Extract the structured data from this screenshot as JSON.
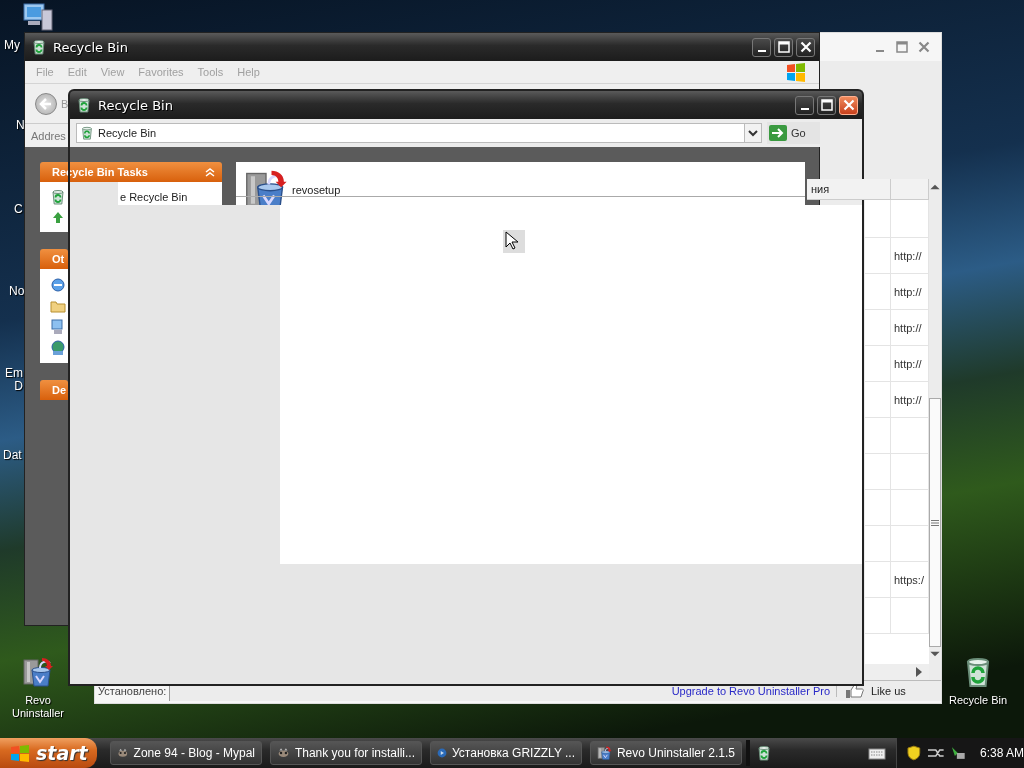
{
  "desktop": {
    "labels_left": [
      {
        "lines": [
          "My"
        ]
      },
      {
        "lines": [
          "N"
        ]
      },
      {
        "lines": [
          "C"
        ]
      },
      {
        "lines": [
          "No"
        ]
      },
      {
        "lines": [
          "Em",
          "D"
        ]
      },
      {
        "lines": [
          "Dat"
        ]
      }
    ],
    "shortcuts": [
      {
        "kind": "revo",
        "label": "Revo Uninstaller"
      },
      {
        "kind": "recycle",
        "label": "Recycle Bin"
      }
    ]
  },
  "revo_window": {
    "column_header": "ния",
    "rows": [
      {},
      {
        "url": "http://"
      },
      {
        "url": "http://"
      },
      {
        "url": "http://"
      },
      {
        "url": "http://"
      },
      {
        "url": "http://"
      },
      {},
      {},
      {},
      {},
      {
        "url": "https:/"
      },
      {}
    ],
    "status_label": "Установлено:",
    "upgrade_link": "Upgrade to Revo Uninstaller Pro",
    "like": "Like us"
  },
  "back_explorer": {
    "title": "Recycle Bin",
    "menu": [
      "File",
      "Edit",
      "View",
      "Favorites",
      "Tools",
      "Help"
    ],
    "back_label": "B",
    "address_label": "Addres",
    "task_panels": [
      {
        "title": "Recycle Bin Tasks",
        "items": [
          "e Recycle Bin"
        ]
      },
      {
        "title": "Ot"
      },
      {
        "title": "De"
      }
    ],
    "files": [
      {
        "name": "revosetup"
      }
    ]
  },
  "front_explorer": {
    "title": "Recycle Bin",
    "address": "Recycle Bin",
    "go": "Go"
  },
  "taskbar": {
    "start": "start",
    "tasks": [
      {
        "kind": "browser",
        "label": "Zone 94 - Blog - Mypal"
      },
      {
        "kind": "browser",
        "label": "Thank you for installi..."
      },
      {
        "kind": "installer",
        "label": "Установка GRIZZLY ..."
      },
      {
        "kind": "revo",
        "label": "Revo Uninstaller 2.1.5"
      }
    ],
    "clock": "6:38 AM"
  }
}
